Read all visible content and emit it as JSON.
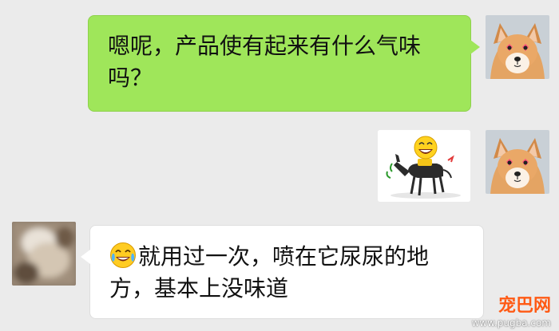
{
  "messages": [
    {
      "side": "outgoing",
      "type": "text",
      "line1": "嗯呢，产品使有起来有什么气味",
      "line2": "吗？"
    },
    {
      "side": "outgoing",
      "type": "sticker",
      "icon": "donkey-laughing-sticker"
    },
    {
      "side": "incoming",
      "type": "text",
      "emoji": "crying-laughing-emoji",
      "line1": "就用过一次，喷在它尿尿的地",
      "line2": "方，基本上没味道"
    }
  ],
  "avatars": {
    "self": "shiba-dog-avatar",
    "contact": "blurred-contact-avatar"
  },
  "watermark": {
    "brand": "宠巴网",
    "url": "www.pugba.com"
  },
  "colors": {
    "background": "#ebebeb",
    "outgoing_bubble": "#9fe65a",
    "incoming_bubble": "#ffffff",
    "watermark_brand": "#ff5a14"
  }
}
